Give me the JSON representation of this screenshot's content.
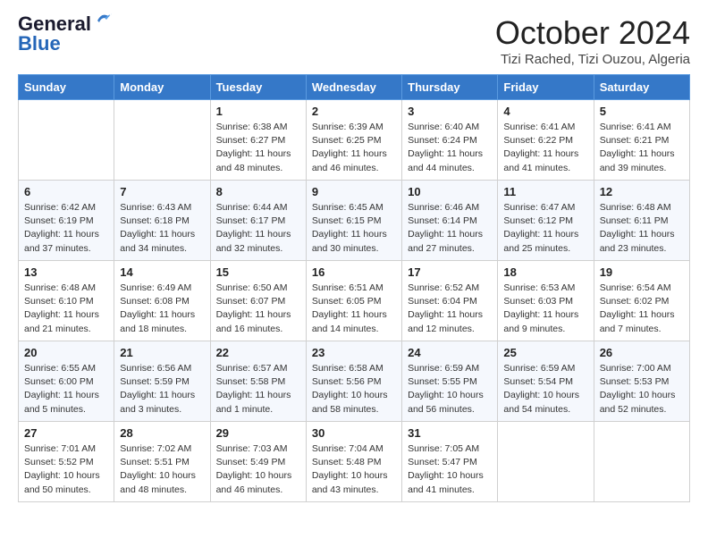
{
  "logo": {
    "general": "General",
    "blue": "Blue"
  },
  "header": {
    "month": "October 2024",
    "location": "Tizi Rached, Tizi Ouzou, Algeria"
  },
  "days_of_week": [
    "Sunday",
    "Monday",
    "Tuesday",
    "Wednesday",
    "Thursday",
    "Friday",
    "Saturday"
  ],
  "weeks": [
    [
      {
        "day": "",
        "info": ""
      },
      {
        "day": "",
        "info": ""
      },
      {
        "day": "1",
        "info": "Sunrise: 6:38 AM\nSunset: 6:27 PM\nDaylight: 11 hours and 48 minutes."
      },
      {
        "day": "2",
        "info": "Sunrise: 6:39 AM\nSunset: 6:25 PM\nDaylight: 11 hours and 46 minutes."
      },
      {
        "day": "3",
        "info": "Sunrise: 6:40 AM\nSunset: 6:24 PM\nDaylight: 11 hours and 44 minutes."
      },
      {
        "day": "4",
        "info": "Sunrise: 6:41 AM\nSunset: 6:22 PM\nDaylight: 11 hours and 41 minutes."
      },
      {
        "day": "5",
        "info": "Sunrise: 6:41 AM\nSunset: 6:21 PM\nDaylight: 11 hours and 39 minutes."
      }
    ],
    [
      {
        "day": "6",
        "info": "Sunrise: 6:42 AM\nSunset: 6:19 PM\nDaylight: 11 hours and 37 minutes."
      },
      {
        "day": "7",
        "info": "Sunrise: 6:43 AM\nSunset: 6:18 PM\nDaylight: 11 hours and 34 minutes."
      },
      {
        "day": "8",
        "info": "Sunrise: 6:44 AM\nSunset: 6:17 PM\nDaylight: 11 hours and 32 minutes."
      },
      {
        "day": "9",
        "info": "Sunrise: 6:45 AM\nSunset: 6:15 PM\nDaylight: 11 hours and 30 minutes."
      },
      {
        "day": "10",
        "info": "Sunrise: 6:46 AM\nSunset: 6:14 PM\nDaylight: 11 hours and 27 minutes."
      },
      {
        "day": "11",
        "info": "Sunrise: 6:47 AM\nSunset: 6:12 PM\nDaylight: 11 hours and 25 minutes."
      },
      {
        "day": "12",
        "info": "Sunrise: 6:48 AM\nSunset: 6:11 PM\nDaylight: 11 hours and 23 minutes."
      }
    ],
    [
      {
        "day": "13",
        "info": "Sunrise: 6:48 AM\nSunset: 6:10 PM\nDaylight: 11 hours and 21 minutes."
      },
      {
        "day": "14",
        "info": "Sunrise: 6:49 AM\nSunset: 6:08 PM\nDaylight: 11 hours and 18 minutes."
      },
      {
        "day": "15",
        "info": "Sunrise: 6:50 AM\nSunset: 6:07 PM\nDaylight: 11 hours and 16 minutes."
      },
      {
        "day": "16",
        "info": "Sunrise: 6:51 AM\nSunset: 6:05 PM\nDaylight: 11 hours and 14 minutes."
      },
      {
        "day": "17",
        "info": "Sunrise: 6:52 AM\nSunset: 6:04 PM\nDaylight: 11 hours and 12 minutes."
      },
      {
        "day": "18",
        "info": "Sunrise: 6:53 AM\nSunset: 6:03 PM\nDaylight: 11 hours and 9 minutes."
      },
      {
        "day": "19",
        "info": "Sunrise: 6:54 AM\nSunset: 6:02 PM\nDaylight: 11 hours and 7 minutes."
      }
    ],
    [
      {
        "day": "20",
        "info": "Sunrise: 6:55 AM\nSunset: 6:00 PM\nDaylight: 11 hours and 5 minutes."
      },
      {
        "day": "21",
        "info": "Sunrise: 6:56 AM\nSunset: 5:59 PM\nDaylight: 11 hours and 3 minutes."
      },
      {
        "day": "22",
        "info": "Sunrise: 6:57 AM\nSunset: 5:58 PM\nDaylight: 11 hours and 1 minute."
      },
      {
        "day": "23",
        "info": "Sunrise: 6:58 AM\nSunset: 5:56 PM\nDaylight: 10 hours and 58 minutes."
      },
      {
        "day": "24",
        "info": "Sunrise: 6:59 AM\nSunset: 5:55 PM\nDaylight: 10 hours and 56 minutes."
      },
      {
        "day": "25",
        "info": "Sunrise: 6:59 AM\nSunset: 5:54 PM\nDaylight: 10 hours and 54 minutes."
      },
      {
        "day": "26",
        "info": "Sunrise: 7:00 AM\nSunset: 5:53 PM\nDaylight: 10 hours and 52 minutes."
      }
    ],
    [
      {
        "day": "27",
        "info": "Sunrise: 7:01 AM\nSunset: 5:52 PM\nDaylight: 10 hours and 50 minutes."
      },
      {
        "day": "28",
        "info": "Sunrise: 7:02 AM\nSunset: 5:51 PM\nDaylight: 10 hours and 48 minutes."
      },
      {
        "day": "29",
        "info": "Sunrise: 7:03 AM\nSunset: 5:49 PM\nDaylight: 10 hours and 46 minutes."
      },
      {
        "day": "30",
        "info": "Sunrise: 7:04 AM\nSunset: 5:48 PM\nDaylight: 10 hours and 43 minutes."
      },
      {
        "day": "31",
        "info": "Sunrise: 7:05 AM\nSunset: 5:47 PM\nDaylight: 10 hours and 41 minutes."
      },
      {
        "day": "",
        "info": ""
      },
      {
        "day": "",
        "info": ""
      }
    ]
  ]
}
